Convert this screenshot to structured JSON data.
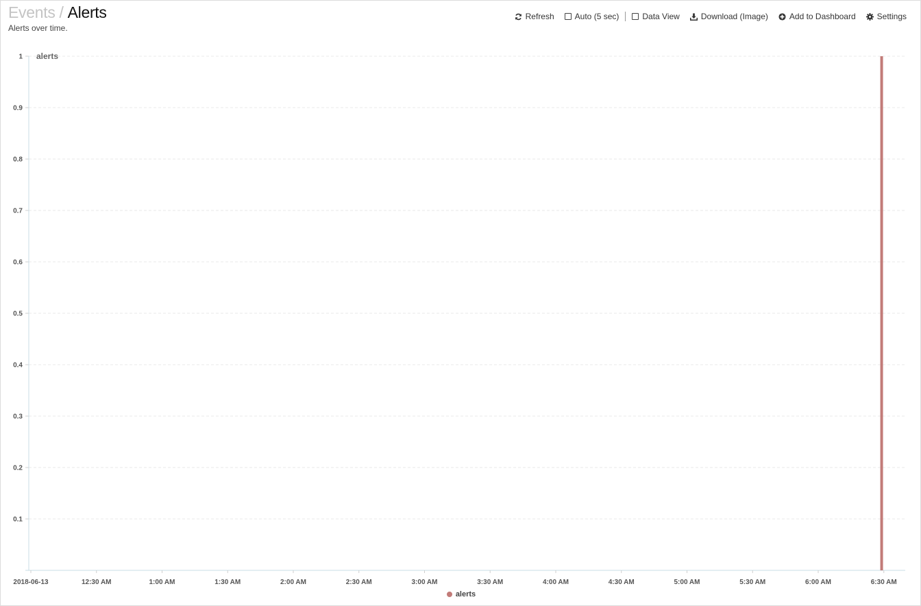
{
  "header": {
    "breadcrumb_parent": "Events",
    "breadcrumb_separator": "/",
    "title": "Alerts",
    "subtitle": "Alerts over time."
  },
  "toolbar": {
    "refresh_label": "Refresh",
    "auto_label": "Auto (5 sec)",
    "auto_checked": false,
    "data_view_label": "Data View",
    "data_view_checked": false,
    "download_label": "Download (Image)",
    "add_dashboard_label": "Add to Dashboard",
    "settings_label": "Settings",
    "icons": [
      "refresh-icon",
      "checkbox-icon",
      "checkbox-icon",
      "download-icon",
      "plus-circle-icon",
      "gear-icon"
    ]
  },
  "chart_data": {
    "type": "bar",
    "title": "",
    "xlabel": "",
    "ylabel": "",
    "x_axis_type": "time",
    "x_range": [
      "2018-06-13 00:00",
      "2018-06-13 06:33"
    ],
    "x_tick_labels": [
      "2018-06-13",
      "12:30 AM",
      "1:00 AM",
      "1:30 AM",
      "2:00 AM",
      "2:30 AM",
      "3:00 AM",
      "3:30 AM",
      "4:00 AM",
      "4:30 AM",
      "5:00 AM",
      "5:30 AM",
      "6:00 AM",
      "6:30 AM"
    ],
    "ylim": [
      0,
      1
    ],
    "y_tick_labels": [
      "0.1",
      "0.2",
      "0.3",
      "0.4",
      "0.5",
      "0.6",
      "0.7",
      "0.8",
      "0.9",
      "1"
    ],
    "grid": true,
    "legend_position": "bottom-center",
    "series": [
      {
        "name": "alerts",
        "color": "#c27b78",
        "points": [
          {
            "x": "2018-06-13 06:29",
            "y": 1
          }
        ]
      }
    ]
  }
}
